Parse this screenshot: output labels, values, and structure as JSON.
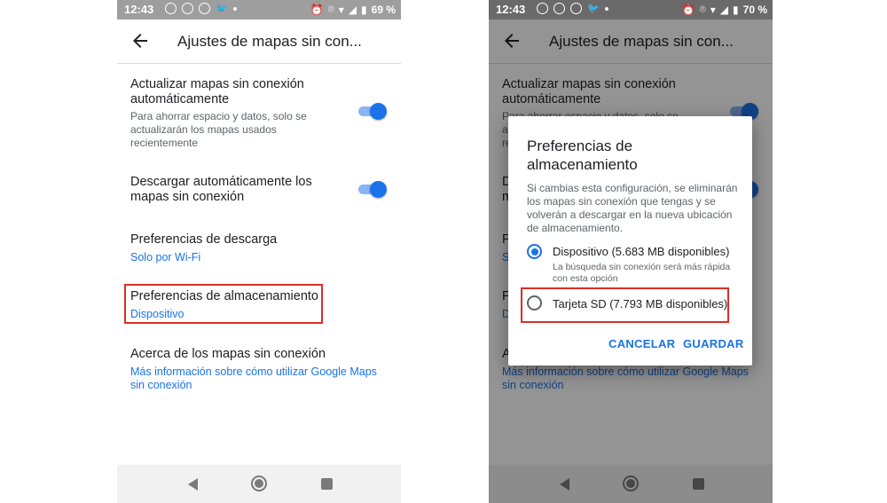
{
  "statusbar_left": {
    "time": "12:43",
    "battery": "69 %"
  },
  "statusbar_right": {
    "time": "12:43",
    "battery": "70 %"
  },
  "appbar": {
    "title": "Ajustes de mapas sin con..."
  },
  "settings": {
    "auto_update": {
      "label": "Actualizar mapas sin conexión automáticamente",
      "description": "Para ahorrar espacio y datos, solo se actualizarán los mapas usados recientemente",
      "enabled": true
    },
    "auto_download": {
      "label": "Descargar automáticamente los mapas sin conexión",
      "enabled": true
    },
    "download_prefs": {
      "label": "Preferencias de descarga",
      "value": "Solo por Wi-Fi"
    },
    "storage_prefs": {
      "label": "Preferencias de almacenamiento",
      "value": "Dispositivo"
    },
    "about": {
      "label": "Acerca de los mapas sin conexión",
      "link": "Más información sobre cómo utilizar Google Maps sin conexión"
    }
  },
  "dialog": {
    "title": "Preferencias de almacenamiento",
    "body": "Si cambias esta configuración, se eliminarán los mapas sin conexión que tengas y se volverán a descargar en la nueva ubicación de almacenamiento.",
    "options": [
      {
        "label": "Dispositivo (5.683 MB disponibles)",
        "description": "La búsqueda sin conexión será más rápida con esta opción",
        "selected": true
      },
      {
        "label": "Tarjeta SD (7.793 MB disponibles)",
        "selected": false
      }
    ],
    "cancel": "CANCELAR",
    "save": "GUARDAR"
  },
  "icons": {
    "back": "arrow-left-icon",
    "status": [
      "spotify-icon",
      "spotify-icon",
      "spotify-icon",
      "twitter-icon",
      "alarm-icon",
      "location-icon",
      "wifi-icon",
      "signal-icon",
      "battery-icon"
    ]
  },
  "colors": {
    "accent": "#1a73e8",
    "highlight": "#d93025"
  }
}
